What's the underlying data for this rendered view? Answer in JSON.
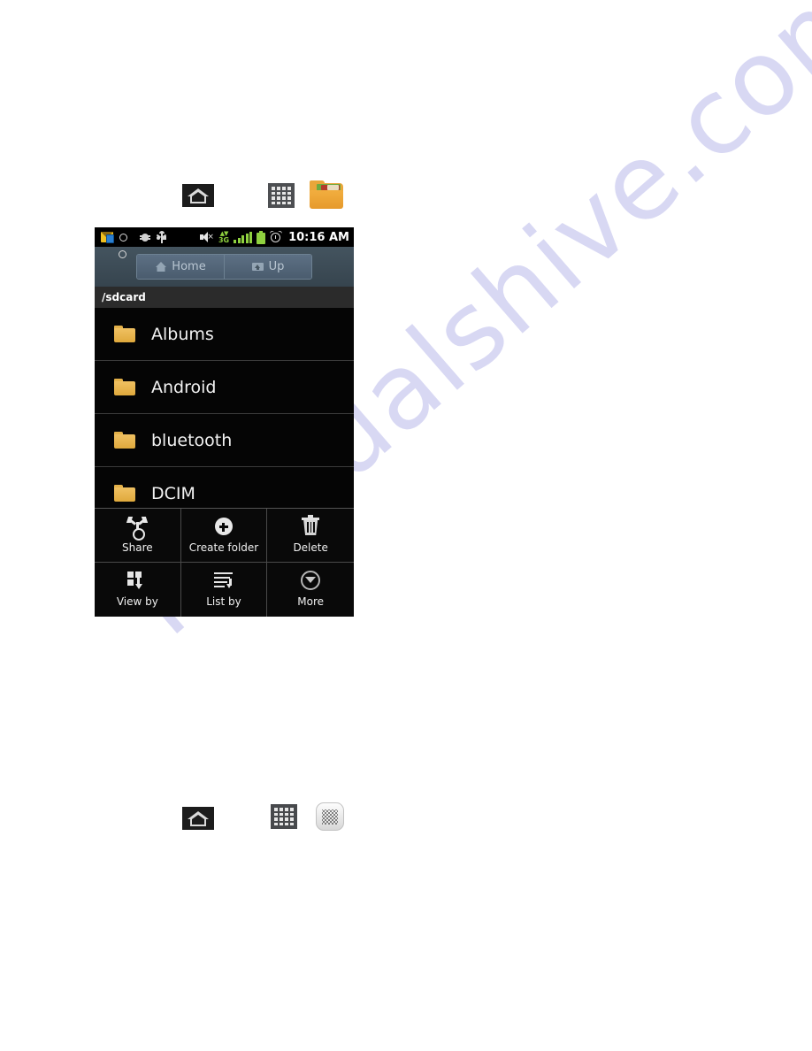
{
  "page": {
    "watermark_text": "manualshive.com"
  },
  "icon_row_top": {
    "items": [
      {
        "name": "home-icon",
        "label": "Home"
      },
      {
        "name": "apps-grid-icon",
        "label": "Applications"
      },
      {
        "name": "my-files-folder-icon",
        "label": "My Files"
      }
    ]
  },
  "icon_row_bottom": {
    "items": [
      {
        "name": "home-icon",
        "label": "Home"
      },
      {
        "name": "apps-grid-icon",
        "label": "Applications"
      },
      {
        "name": "mesh-settings-icon",
        "label": "Options"
      }
    ]
  },
  "phone": {
    "statusbar": {
      "icons": [
        "message-badge-icon",
        "voicemail-icon",
        "debug-bug-icon",
        "usb-icon",
        "mute-speaker-icon",
        "data-3g-icon",
        "signal-bars-icon",
        "battery-icon",
        "alarm-clock-icon"
      ],
      "data_label": "3G",
      "time": "10:16 AM"
    },
    "toolbar": {
      "home_label": "Home",
      "up_label": "Up"
    },
    "path": "/sdcard",
    "files": [
      {
        "name": "Albums",
        "icon": "folder-icon"
      },
      {
        "name": "Android",
        "icon": "folder-icon"
      },
      {
        "name": "bluetooth",
        "icon": "folder-icon"
      },
      {
        "name": "DCIM",
        "icon": "folder-icon"
      }
    ],
    "options_menu": [
      {
        "label": "Share",
        "icon": "share-icon"
      },
      {
        "label": "Create folder",
        "icon": "plus-circle-icon"
      },
      {
        "label": "Delete",
        "icon": "trash-icon"
      },
      {
        "label": "View by",
        "icon": "view-by-icon"
      },
      {
        "label": "List by",
        "icon": "list-by-icon"
      },
      {
        "label": "More",
        "icon": "more-chevron-icon"
      }
    ]
  },
  "colors": {
    "toolbar": "#3c4a55",
    "toolbar_button": "#55677c",
    "path_bar": "#2b2b2b",
    "folder": "#e3b149",
    "status_green": "#8fd13f",
    "watermark": "#ccccf0"
  }
}
